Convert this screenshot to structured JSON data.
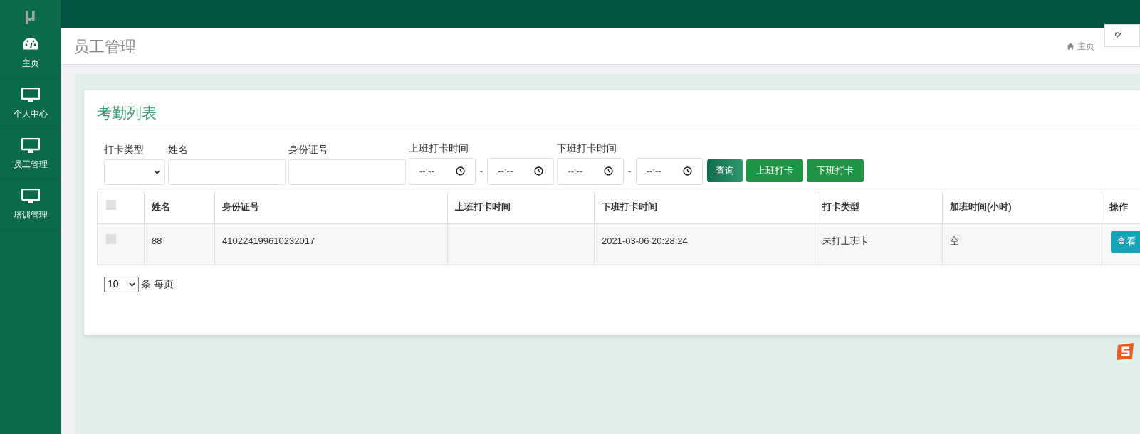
{
  "sidebar": {
    "logo": "μ",
    "items": [
      {
        "label": "主页",
        "kind": "dashboard",
        "selected": false
      },
      {
        "label": "个人中心",
        "kind": "monitor",
        "selected": false
      },
      {
        "label": "员工管理",
        "kind": "monitor",
        "selected": false
      },
      {
        "label": "培训管理",
        "kind": "monitor",
        "selected": false
      }
    ]
  },
  "header": {
    "title": "员工管理",
    "breadcrumb": "主页"
  },
  "card": {
    "title": "考勤列表",
    "filters": [
      {
        "kind": "select",
        "label": "打卡类型"
      },
      {
        "kind": "text",
        "label": "姓名"
      },
      {
        "kind": "text",
        "label": "身份证号"
      },
      {
        "kind": "timerange",
        "label": "上班打卡时间",
        "from": "--:--",
        "separator": "-",
        "to": "--:--"
      },
      {
        "kind": "timerange",
        "label": "下班打卡时间",
        "from": "--:--",
        "separator": "-",
        "to": "--:--"
      }
    ],
    "buttons": [
      {
        "label": "查询",
        "kind": "search"
      },
      {
        "label": "上班打卡",
        "kind": "action"
      },
      {
        "label": "下班打卡",
        "kind": "action"
      }
    ],
    "table": {
      "columns": [
        "姓名",
        "身份证号",
        "上班打卡时间",
        "下班打卡时间",
        "打卡类型",
        "加班时间(小时)",
        "操作"
      ],
      "rows": [
        {
          "checked": false,
          "cells": [
            "88",
            "410224199610232017",
            "",
            "2021-03-06 20:28:24",
            "未打上班卡",
            "空"
          ],
          "action": "查看"
        }
      ],
      "header_checked": false
    },
    "page_size": "10",
    "page_size_label": "条 每页"
  }
}
